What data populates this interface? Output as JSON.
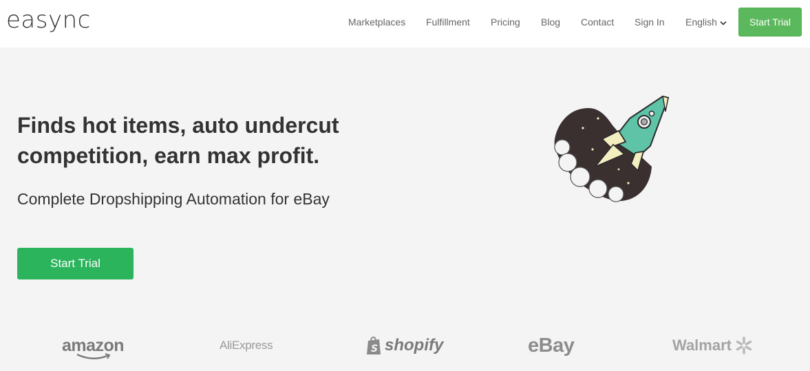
{
  "brand": {
    "name": "easync"
  },
  "nav": {
    "items": [
      {
        "label": "Marketplaces"
      },
      {
        "label": "Fulfillment"
      },
      {
        "label": "Pricing"
      },
      {
        "label": "Blog"
      },
      {
        "label": "Contact"
      },
      {
        "label": "Sign In"
      }
    ],
    "language": "English",
    "cta_label": "Start Trial"
  },
  "hero": {
    "title": "Finds hot items, auto undercut competition, earn max profit.",
    "subtitle": "Complete Dropshipping Automation for eBay",
    "cta_label": "Start Trial"
  },
  "partners": [
    {
      "name": "amazon",
      "icon": "amazon-smile"
    },
    {
      "name": "AliExpress"
    },
    {
      "name": "shopify",
      "icon": "shopping-bag"
    },
    {
      "name": "eBay"
    },
    {
      "name": "Walmart",
      "icon": "walmart-spark"
    }
  ],
  "colors": {
    "primary_green": "#2bb45c",
    "nav_button_green": "#5cb85c",
    "background": "#f4f4f4",
    "header_bg": "#ffffff",
    "rocket_teal": "#5fc3a8",
    "rocket_cream": "#f4efc0",
    "rocket_space": "#3a3030"
  }
}
